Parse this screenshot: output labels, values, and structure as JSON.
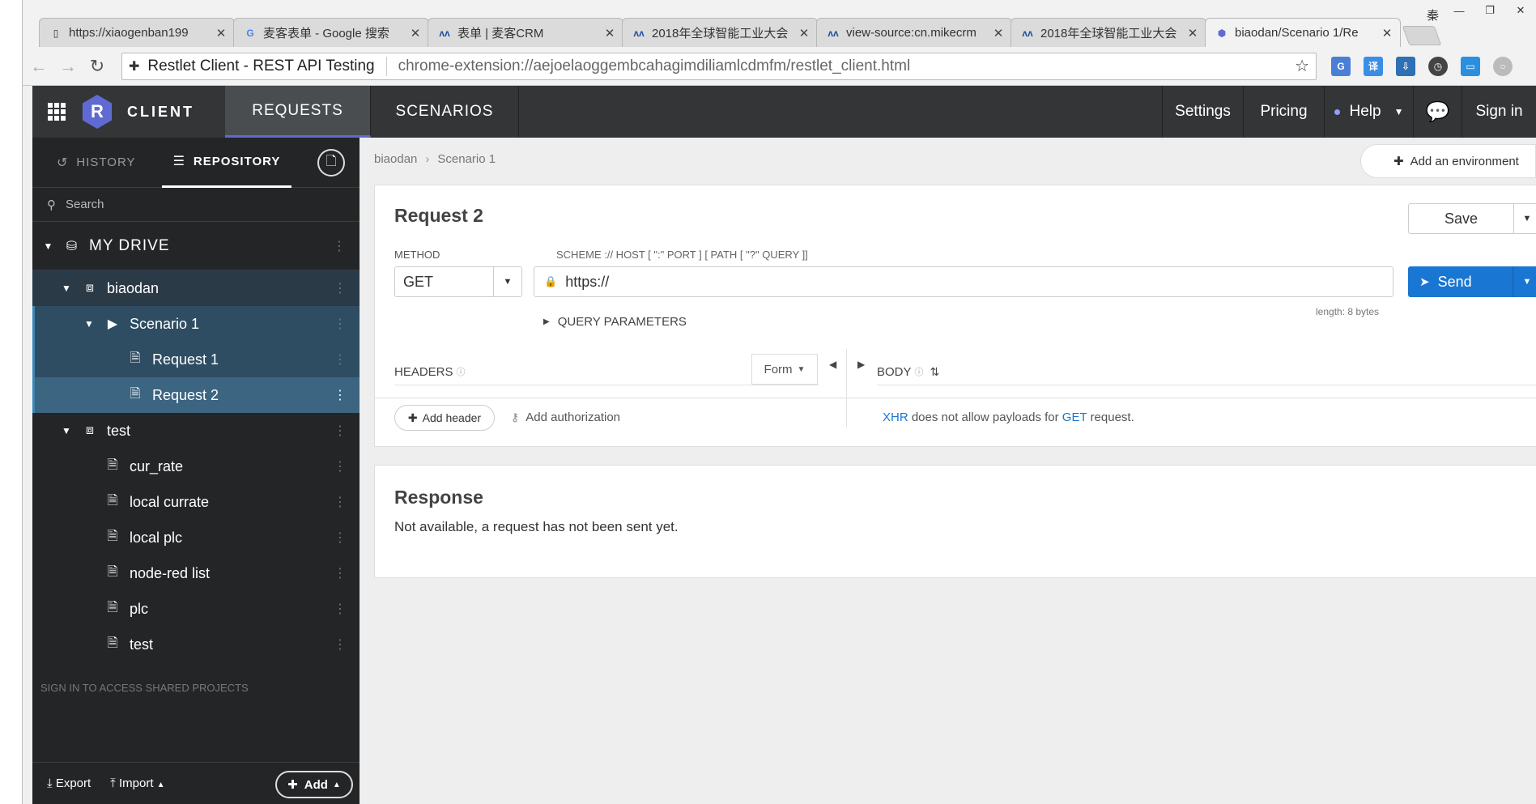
{
  "browser": {
    "window_user": "秦",
    "window_controls": [
      "—",
      "❐",
      "✕"
    ],
    "tabs": [
      {
        "title": "https://xiaogenban199",
        "favicon": "page-icon"
      },
      {
        "title": "麦客表单 - Google 搜索",
        "favicon": "google-icon"
      },
      {
        "title": "表单 | 麦客CRM",
        "favicon": "mikecrm-icon"
      },
      {
        "title": "2018年全球智能工业大会",
        "favicon": "mikecrm-icon"
      },
      {
        "title": "view-source:cn.mikecrm",
        "favicon": "mikecrm-icon"
      },
      {
        "title": "2018年全球智能工业大会",
        "favicon": "mikecrm-icon"
      },
      {
        "title": "biaodan/Scenario 1/Re",
        "favicon": "restlet-icon",
        "active": true
      }
    ],
    "site_name": "Restlet Client - REST API Testing",
    "url": "chrome-extension://aejoelaoggembcahagimdiliamlcdmfm/restlet_client.html"
  },
  "app": {
    "logo_letter": "R",
    "brand": "CLIENT",
    "nav": {
      "requests": "REQUESTS",
      "scenarios": "SCENARIOS",
      "settings": "Settings",
      "pricing": "Pricing",
      "help": "Help",
      "signin": "Sign in"
    }
  },
  "sidebar": {
    "tab_history": "HISTORY",
    "tab_repository": "REPOSITORY",
    "search_placeholder": "Search",
    "my_drive": "MY DRIVE",
    "tree": [
      {
        "label": "biaodan",
        "type": "project"
      },
      {
        "label": "Scenario 1",
        "type": "scenario"
      },
      {
        "label": "Request 1",
        "type": "request"
      },
      {
        "label": "Request 2",
        "type": "request",
        "selected": true
      },
      {
        "label": "test",
        "type": "project"
      },
      {
        "label": "cur_rate",
        "type": "request"
      },
      {
        "label": "local currate",
        "type": "request"
      },
      {
        "label": "local plc",
        "type": "request"
      },
      {
        "label": "node-red list",
        "type": "request"
      },
      {
        "label": "plc",
        "type": "request"
      },
      {
        "label": "test",
        "type": "request"
      }
    ],
    "shared_note": "SIGN IN TO ACCESS SHARED PROJECTS",
    "footer": {
      "export": "Export",
      "import": "Import",
      "add": "Add"
    }
  },
  "main": {
    "breadcrumb": [
      "biaodan",
      "Scenario 1"
    ],
    "add_environment": "Add an environment",
    "request": {
      "title": "Request 2",
      "save": "Save",
      "method_label": "METHOD",
      "url_label": "SCHEME :// HOST [ \":\" PORT ] [ PATH [ \"?\" QUERY ]]",
      "method": "GET",
      "url": "https://",
      "send": "Send",
      "length_note": "length: 8 bytes",
      "query_parameters": "QUERY PARAMETERS",
      "headers_label": "HEADERS",
      "form_select": "Form",
      "body_label": "BODY",
      "add_header": "Add header",
      "add_authorization": "Add authorization",
      "xhr_link": "XHR",
      "xhr_mid": " does not allow payloads for ",
      "get_link": "GET",
      "xhr_end": " request."
    },
    "response": {
      "title": "Response",
      "text": "Not available, a request has not been sent yet."
    }
  },
  "colors": {
    "nav_bg": "#333537",
    "sidebar_bg": "#242527",
    "accent": "#5f6bd3",
    "send_blue": "#1976d2",
    "selected_row": "#3c6581"
  }
}
